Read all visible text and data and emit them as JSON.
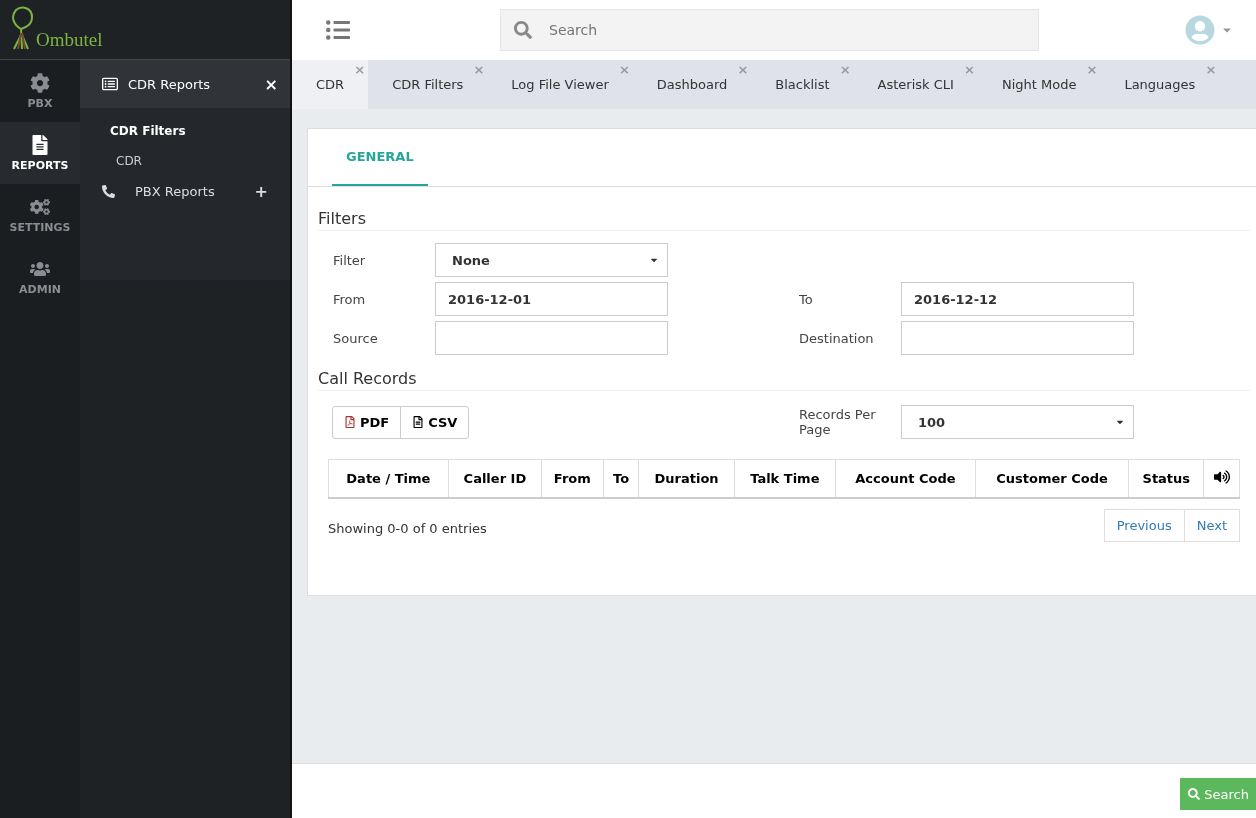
{
  "logo": {
    "name": "Ombutel"
  },
  "rail": [
    {
      "label": "PBX",
      "selected": false
    },
    {
      "label": "REPORTS",
      "selected": true
    },
    {
      "label": "SETTINGS",
      "selected": false
    },
    {
      "label": "ADMIN",
      "selected": false
    }
  ],
  "submenu": {
    "title": "CDR Reports",
    "close": "×",
    "items": [
      {
        "label": "CDR Filters",
        "selected": true
      },
      {
        "label": "CDR",
        "selected": false
      }
    ],
    "group": {
      "label": "PBX Reports",
      "expand": "+"
    }
  },
  "search": {
    "placeholder": "Search"
  },
  "tabs": [
    {
      "label": "CDR",
      "selected": true
    },
    {
      "label": "CDR Filters",
      "selected": false
    },
    {
      "label": "Log File Viewer",
      "selected": false
    },
    {
      "label": "Dashboard",
      "selected": false
    },
    {
      "label": "Blacklist",
      "selected": false
    },
    {
      "label": "Asterisk CLI",
      "selected": false
    },
    {
      "label": "Night Mode",
      "selected": false
    },
    {
      "label": "Languages",
      "selected": false
    }
  ],
  "tab_close": "×",
  "panel_tabs": [
    {
      "label": "GENERAL",
      "selected": true
    }
  ],
  "filters": {
    "title": "Filters",
    "filter": {
      "label": "Filter",
      "value": "None"
    },
    "from": {
      "label": "From",
      "value": "2016-12-01"
    },
    "to": {
      "label": "To",
      "value": "2016-12-12"
    },
    "source": {
      "label": "Source"
    },
    "destination": {
      "label": "Destination"
    }
  },
  "records": {
    "title": "Call Records",
    "exports": [
      "PDF",
      "CSV"
    ],
    "per_page": {
      "label": "Records Per Page",
      "value": "100"
    },
    "columns": [
      "Date / Time",
      "Caller ID",
      "From",
      "To",
      "Duration",
      "Talk Time",
      "Account Code",
      "Customer Code",
      "Status"
    ],
    "info": "Showing 0-0 of 0 entries",
    "pager": [
      "Previous",
      "Next"
    ]
  },
  "search_button": "Search"
}
